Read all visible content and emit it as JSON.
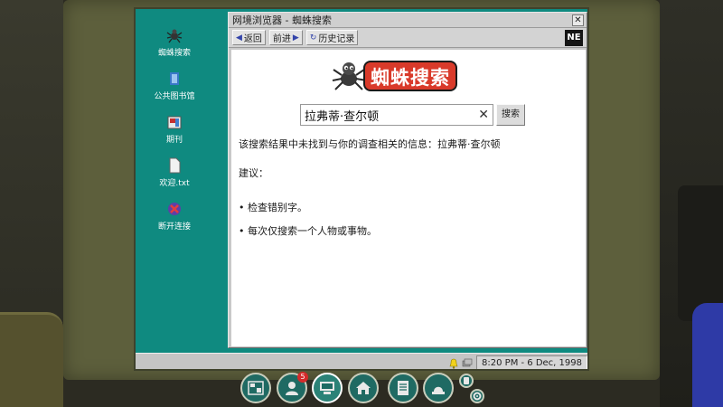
{
  "desktop": {
    "icons": [
      {
        "label": "蜘蛛搜索",
        "icon": "spider-icon"
      },
      {
        "label": "公共图书馆",
        "icon": "library-icon"
      },
      {
        "label": "期刊",
        "icon": "journal-icon"
      },
      {
        "label": "欢迎.txt",
        "icon": "text-file-icon"
      },
      {
        "label": "断开连接",
        "icon": "disconnect-icon"
      }
    ]
  },
  "window": {
    "title": "网境浏览器 - 蜘蛛搜索",
    "close_label": "✕",
    "toolbar": {
      "back_label": "返回",
      "forward_label": "前进",
      "history_label": "历史记录",
      "logo_text": "NE"
    }
  },
  "page": {
    "brand_title": "蜘蛛搜索",
    "search": {
      "value": "拉弗蒂·查尔顿",
      "button_label": "搜索",
      "clear_label": "✕"
    },
    "result_message": "该搜索结果中未找到与你的调查相关的信息：拉弗蒂·查尔顿",
    "suggestions_heading": "建议：",
    "suggestions": [
      "• 检查错别字。",
      "• 每次仅搜索一个人物或事物。"
    ]
  },
  "taskbar": {
    "clock": "8:20 PM - 6 Dec, 1998"
  },
  "dock": {
    "items": [
      {
        "icon": "evidence-board-icon"
      },
      {
        "icon": "suspect-icon",
        "badge": "5"
      },
      {
        "icon": "computer-icon",
        "active": true
      },
      {
        "icon": "home-icon"
      },
      {
        "icon": "notebook-icon"
      },
      {
        "icon": "alarm-icon"
      }
    ],
    "mini": [
      "phone-icon",
      "settings-icon"
    ]
  },
  "colors": {
    "desktop": "#0f8a80",
    "brand_red": "#d93a2a",
    "window_gray": "#c9c9c9"
  }
}
